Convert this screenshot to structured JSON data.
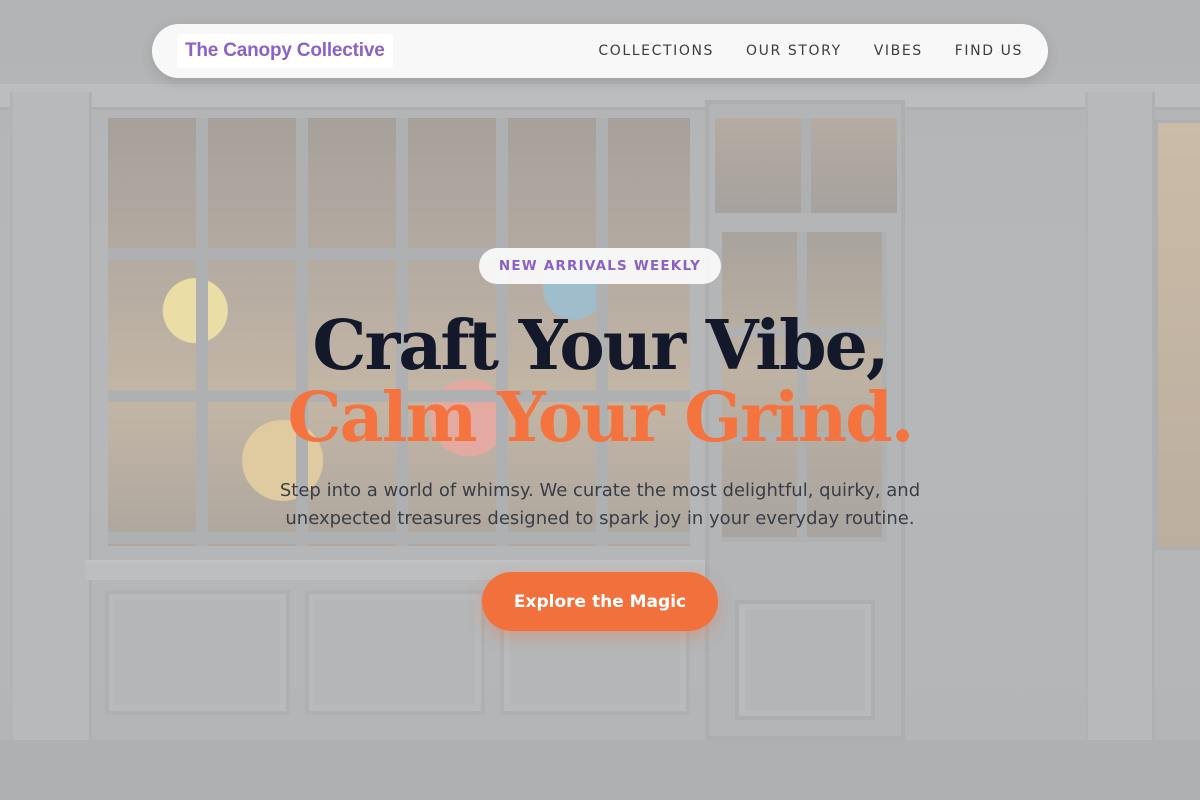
{
  "navbar": {
    "brand": "The Canopy Collective",
    "links": [
      "COLLECTIONS",
      "OUR STORY",
      "VIBES",
      "FIND US"
    ]
  },
  "hero": {
    "badge": "NEW ARRIVALS WEEKLY",
    "headline_line1": "Craft Your Vibe,",
    "headline_line2": "Calm Your Grind.",
    "subtext": "Step into a world of whimsy. We curate the most delightful, quirky, and unexpected treasures designed to spark joy in your everyday routine.",
    "cta_label": "Explore the Magic"
  },
  "colors": {
    "brand_purple": "#8b61c6",
    "accent_orange": "#f2703c",
    "headline_dark": "#14182b"
  }
}
